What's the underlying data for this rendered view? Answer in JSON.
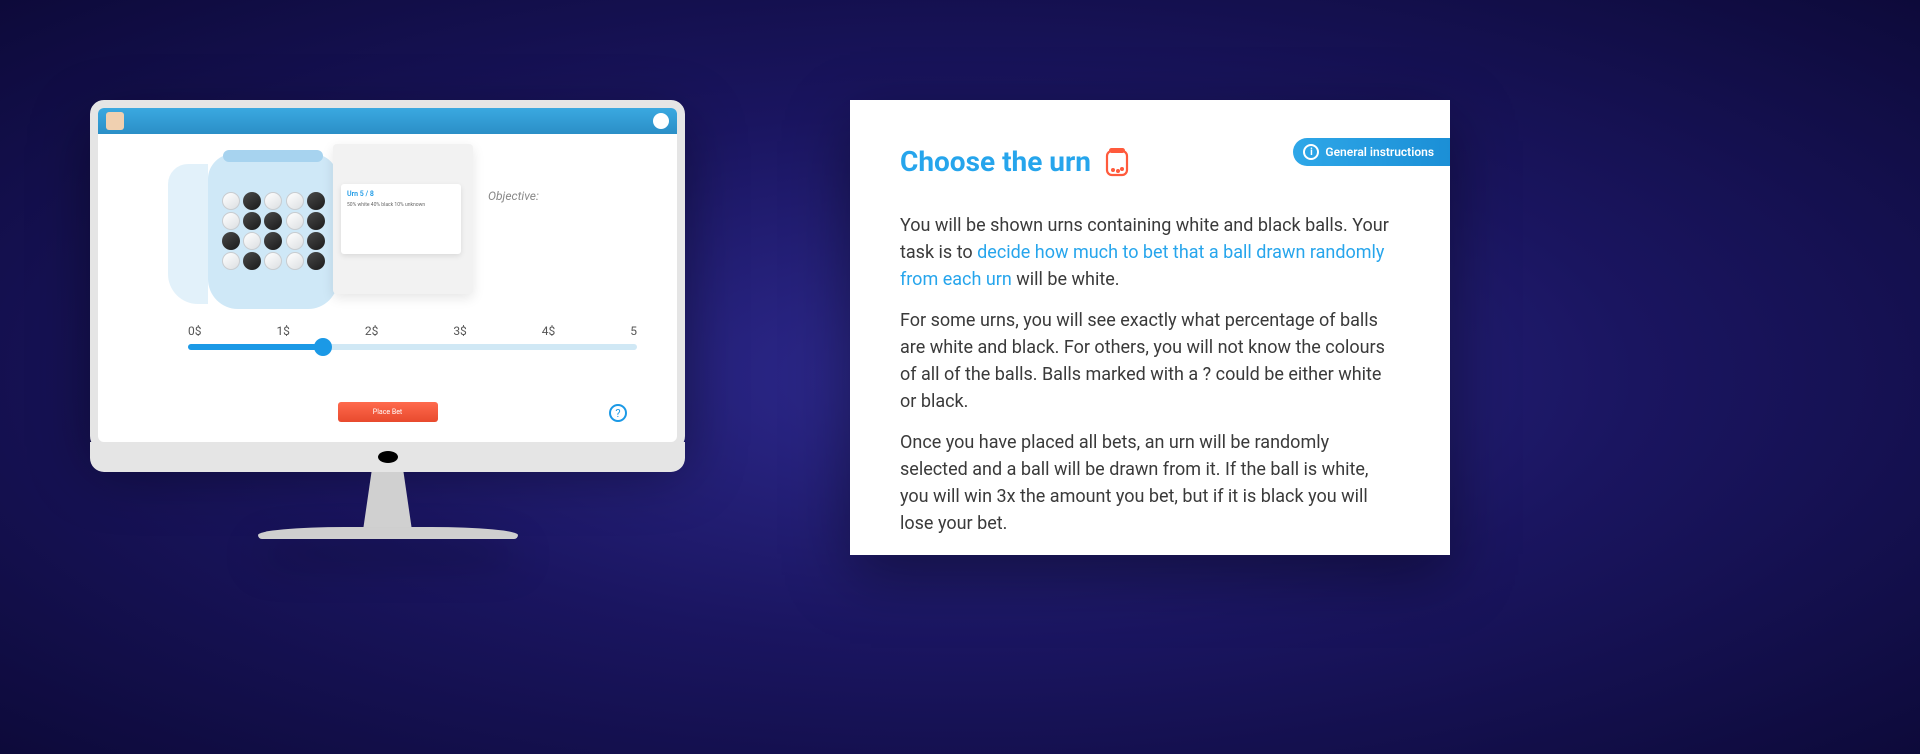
{
  "monitor": {
    "info_card": {
      "title": "Urn 5 / 8",
      "lines": "50% white\n40% black\n10% unknown"
    },
    "objective_label": "Objective:",
    "slider": {
      "ticks": [
        "0$",
        "1$",
        "2$",
        "3$",
        "4$",
        "5"
      ]
    },
    "submit_label": "Place Bet",
    "help_glyph": "?"
  },
  "card": {
    "title": "Choose the urn",
    "gi_label": "General instructions",
    "p1_a": "You will be shown urns containing white and black balls. Your task is to ",
    "p1_hl": "decide how much to bet that a ball drawn randomly from each urn",
    "p1_b": " will be white.",
    "p2": "For some urns, you will see exactly what percentage of balls are white and black. For others, you will not know the colours of all of the balls. Balls marked with a ? could be either white or black.",
    "p3": "Once you have placed all bets, an urn will be randomly selected and a ball will be drawn from it. If the ball is white, you will win 3x the amount you bet, but if it is black you will lose your bet."
  },
  "balls_layout": [
    "white",
    "black",
    "white",
    "white",
    "black",
    "white",
    "black",
    "black",
    "white",
    "black",
    "black",
    "white",
    "black",
    "white",
    "black",
    "white",
    "black",
    "white",
    "white",
    "black"
  ]
}
